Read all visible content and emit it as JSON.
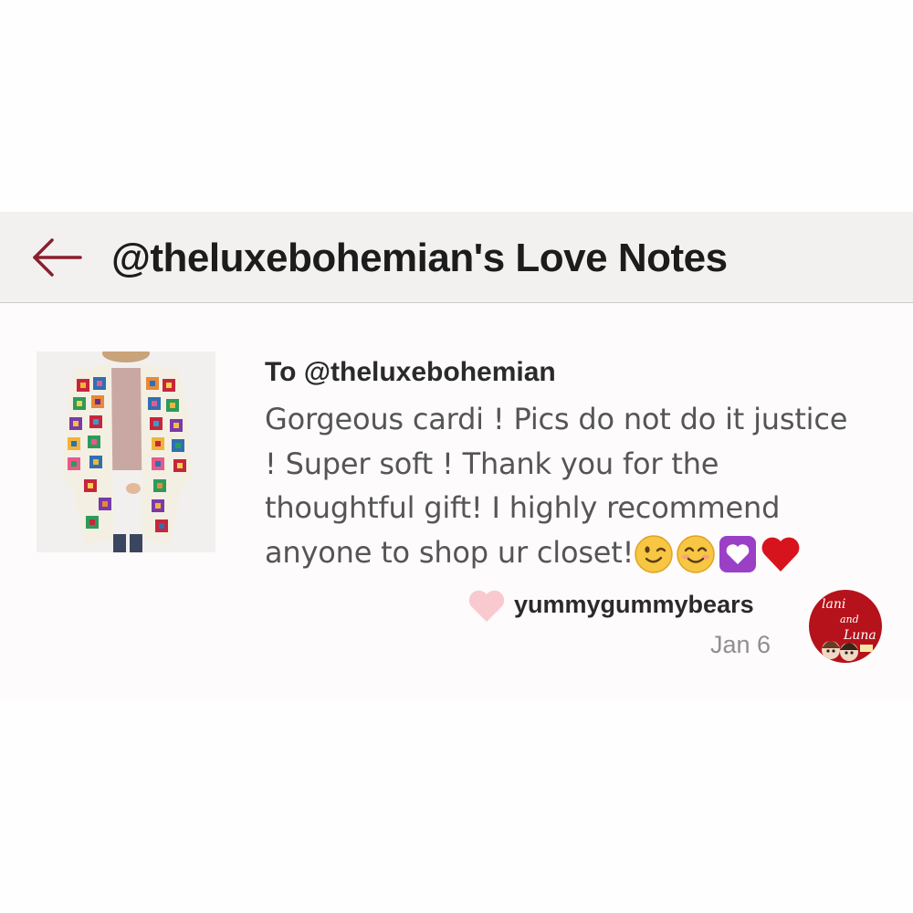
{
  "header": {
    "title": "@theluxebohemian's Love Notes",
    "back_icon": "arrow-left-icon",
    "back_color": "#8a1f2d"
  },
  "note": {
    "to": "To @theluxebohemian",
    "body_line1": "Gorgeous cardi ! Pics do not do it justice",
    "body_line2": "! Super soft ! Thank you for the",
    "body_line3": "thoughtful gift! I highly recommend",
    "body_line4": "anyone to shop ur closet!",
    "emojis": [
      "winking-face-icon",
      "smiling-face-icon",
      "heart-decoration-icon",
      "red-heart-icon"
    ],
    "like_icon": "heart-icon",
    "like_color": "#f9c9d0",
    "author": "yummygummybears",
    "date": "Jan 6",
    "product_image": "crochet-cardigan-photo"
  },
  "avatar": {
    "lettering": "lani and Luna",
    "background": "#b5121b"
  }
}
